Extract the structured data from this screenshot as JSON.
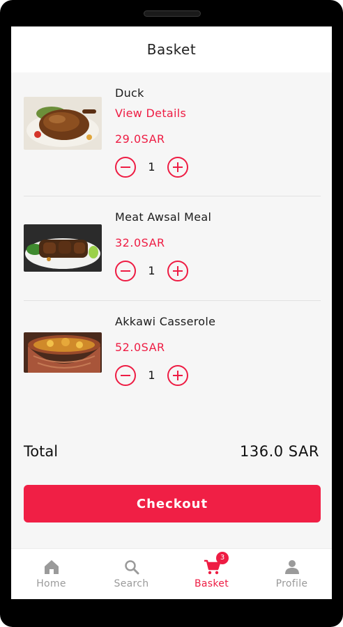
{
  "header": {
    "title": "Basket"
  },
  "items": [
    {
      "name": "Duck",
      "link": "View Details",
      "price": "29.0SAR",
      "qty": "1",
      "image": "roast-duck-photo"
    },
    {
      "name": "Meat Awsal Meal",
      "price": "32.0SAR",
      "qty": "1",
      "image": "grilled-meat-photo"
    },
    {
      "name": "Akkawi Casserole",
      "price": "52.0SAR",
      "qty": "1",
      "image": "clay-casserole-photo"
    }
  ],
  "total": {
    "label": "Total",
    "value": "136.0 SAR"
  },
  "checkout": {
    "label": "Checkout"
  },
  "tabs": [
    {
      "label": "Home",
      "icon": "home-icon"
    },
    {
      "label": "Search",
      "icon": "search-icon"
    },
    {
      "label": "Basket",
      "icon": "cart-icon",
      "badge": "3",
      "active": true
    },
    {
      "label": "Profile",
      "icon": "person-icon"
    }
  ],
  "colors": {
    "accent": "#ee1c43",
    "inactive": "#9a9a9a",
    "background": "#f6f6f6"
  }
}
